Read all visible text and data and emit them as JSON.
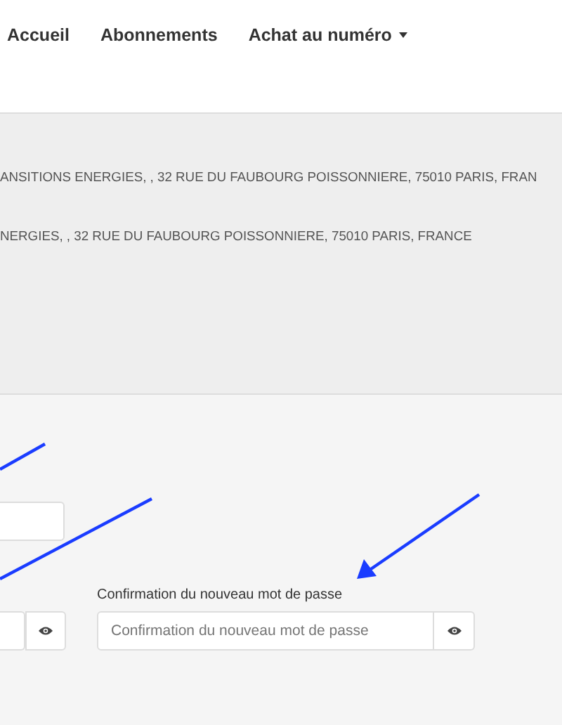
{
  "nav": [
    {
      "label": "Accueil",
      "dropdown": false
    },
    {
      "label": "Abonnements",
      "dropdown": false
    },
    {
      "label": "Achat au numéro",
      "dropdown": true
    }
  ],
  "addresses": [
    "ANSITIONS ENERGIES, , 32 RUE DU FAUBOURG POISSONNIERE, 75010 PARIS, FRAN",
    "NERGIES, , 32 RUE DU FAUBOURG POISSONNIERE, 75010 PARIS, FRANCE"
  ],
  "confirm_field": {
    "label": "Confirmation du nouveau mot de passe",
    "placeholder": "Confirmation du nouveau mot de passe"
  }
}
